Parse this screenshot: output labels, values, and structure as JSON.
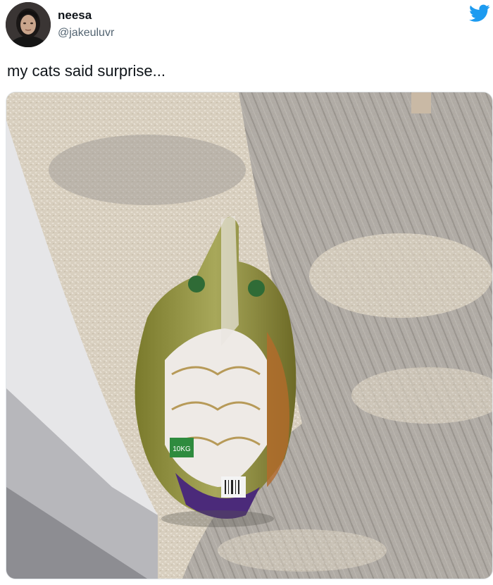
{
  "tweet": {
    "display_name": "neesa",
    "handle": "@jakeuluvr",
    "text": "my cats said surprise...",
    "avatar_icon": "user-avatar",
    "platform_icon": "twitter-bird-icon",
    "brand_color": "#1d9bf0"
  },
  "media": {
    "description_icon": "photo",
    "bag_weight_label": "10KG"
  }
}
